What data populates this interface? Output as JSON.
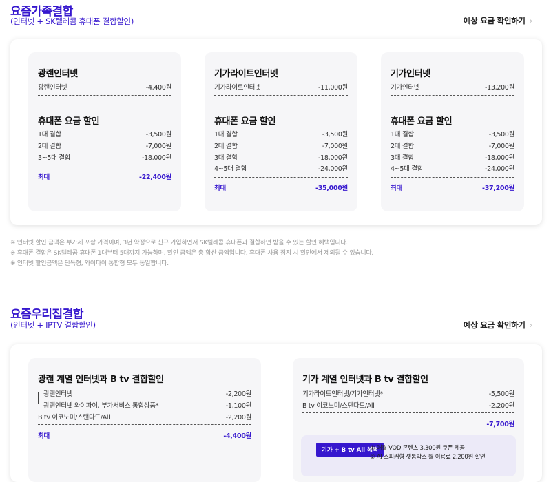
{
  "family": {
    "title": "요즘가족결합",
    "subtitle": "(인터넷 + SK텔레콤 휴대폰 결합할인)",
    "calc_link": "예상 요금 확인하기",
    "cards": [
      {
        "internet_title": "광랜인터넷",
        "internet_label": "광랜인터넷",
        "internet_value": "-4,400원",
        "phone_title": "휴대폰 요금 할인",
        "phone_rows": [
          {
            "label": "1대 결합",
            "value": "-3,500원"
          },
          {
            "label": "2대 결합",
            "value": "-7,000원"
          },
          {
            "label": "3~5대 결합",
            "value": "-18,000원"
          }
        ],
        "max_label": "최대",
        "max_value": "-22,400원"
      },
      {
        "internet_title": "기가라이트인터넷",
        "internet_label": "기가라이트인터넷",
        "internet_value": "-11,000원",
        "phone_title": "휴대폰 요금 할인",
        "phone_rows": [
          {
            "label": "1대 결합",
            "value": "-3,500원"
          },
          {
            "label": "2대 결합",
            "value": "-7,000원"
          },
          {
            "label": "3대 결합",
            "value": "-18,000원"
          },
          {
            "label": "4~5대 결합",
            "value": "-24,000원"
          }
        ],
        "max_label": "최대",
        "max_value": "-35,000원"
      },
      {
        "internet_title": "기가인터넷",
        "internet_label": "기가인터넷",
        "internet_value": "-13,200원",
        "phone_title": "휴대폰 요금 할인",
        "phone_rows": [
          {
            "label": "1대 결합",
            "value": "-3,500원"
          },
          {
            "label": "2대 결합",
            "value": "-7,000원"
          },
          {
            "label": "3대 결합",
            "value": "-18,000원"
          },
          {
            "label": "4~5대 결합",
            "value": "-24,000원"
          }
        ],
        "max_label": "최대",
        "max_value": "-37,200원"
      }
    ],
    "notes": [
      "※ 인터넷 할인 금액은 부가세 포함 가격이며, 3년 약정으로 신규 가입하면서 SK텔레콤 휴대폰과 결합하면 받을 수 있는 할인 혜택입니다.",
      "※ 휴대폰 결합은 SK텔레콤 휴대폰 1대부터 5대까지 가능하며, 할인 금액은 총 합산 금액입니다. 휴대폰 사용 정지 시 할인에서 제외될 수 있습니다.",
      "※ 인터넷 할인금액은 단독형, 와이파이 통합형 모두 동일합니다."
    ]
  },
  "home": {
    "title": "요즘우리집결합",
    "subtitle": "(인터넷 + IPTV 결합할인)",
    "calc_link": "예상 요금 확인하기",
    "card1": {
      "title": "광랜 계열 인터넷과 B tv 결합할인",
      "rows": [
        {
          "label": "광랜인터넷",
          "value": "-2,200원"
        },
        {
          "label": "광랜인터넷 와이파이, 부가서비스 통합상품*",
          "value": "-1,100원"
        },
        {
          "label": "B tv 이코노미/스탠다드/All",
          "value": "-2,200원"
        }
      ],
      "max_label": "최대",
      "max_value": "-4,400원"
    },
    "card2": {
      "title": "기가 계열 인터넷과 B tv 결합할인",
      "rows": [
        {
          "label": "기가라이트인터넷/기가인터넷*",
          "value": "-5,500원"
        },
        {
          "label": "B tv 이코노미/스탠다드/All",
          "value": "-2,200원"
        }
      ],
      "total_value": "-7,700원",
      "badge": "기가 + B tv All 혜택",
      "benefits": [
        "① 매월 VOD 콘텐츠 3,300원 쿠폰 제공",
        "② AI 스피커형 셋톱박스 월 이용료 2,200원 할인"
      ]
    }
  }
}
